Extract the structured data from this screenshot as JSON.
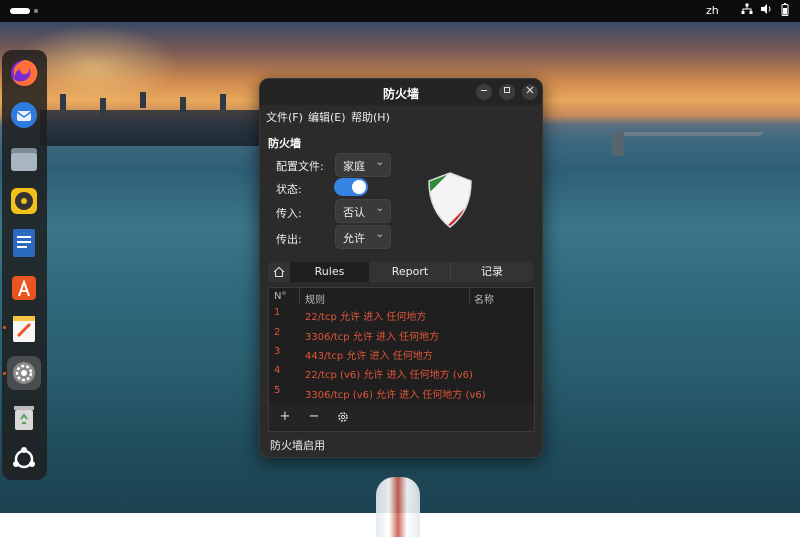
{
  "topbar": {
    "language": "zh"
  },
  "dock": {
    "items": [
      {
        "name": "firefox-icon",
        "color": "#ff7139"
      },
      {
        "name": "thunderbird-icon",
        "color": "#2f7bdd"
      },
      {
        "name": "files-icon",
        "color": "#7b8a96"
      },
      {
        "name": "rhythmbox-icon",
        "color": "#f2c21b"
      },
      {
        "name": "libreoffice-writer-icon",
        "color": "#2a6bbf"
      },
      {
        "name": "app-center-icon",
        "color": "#e95420"
      },
      {
        "name": "text-editor-icon",
        "color": "#f4c542"
      },
      {
        "name": "settings-icon",
        "color": "#999999"
      },
      {
        "name": "trash-icon",
        "color": "#5aa05a"
      },
      {
        "name": "show-apps-icon",
        "color": "#ffffff"
      }
    ]
  },
  "window": {
    "title": "防火墙",
    "menu": [
      "文件(F)",
      "编辑(E)",
      "帮助(H)"
    ],
    "section_title": "防火墙",
    "profile_label": "配置文件:",
    "profile_value": "家庭",
    "status_label": "状态:",
    "status_on": true,
    "incoming_label": "传入:",
    "incoming_value": "否认",
    "outgoing_label": "传出:",
    "outgoing_value": "允许",
    "tabs": [
      "Rules",
      "Report",
      "记录"
    ],
    "active_tab": "Rules",
    "table": {
      "headers": [
        "N°",
        "规则",
        "名称"
      ],
      "rows": [
        {
          "num": "1",
          "rule": "22/tcp 允许 进入 任何地方"
        },
        {
          "num": "2",
          "rule": "3306/tcp 允许 进入 任何地方"
        },
        {
          "num": "3",
          "rule": "443/tcp 允许 进入 任何地方"
        },
        {
          "num": "4",
          "rule": "22/tcp (v6) 允许 进入 任何地方 (v6)"
        },
        {
          "num": "5",
          "rule": "3306/tcp (v6) 允许 进入 任何地方 (v6)"
        }
      ]
    },
    "toolbar": {
      "add": "+",
      "remove": "−",
      "settings_icon": "gear-icon"
    },
    "status_text": "防火墙启用"
  }
}
